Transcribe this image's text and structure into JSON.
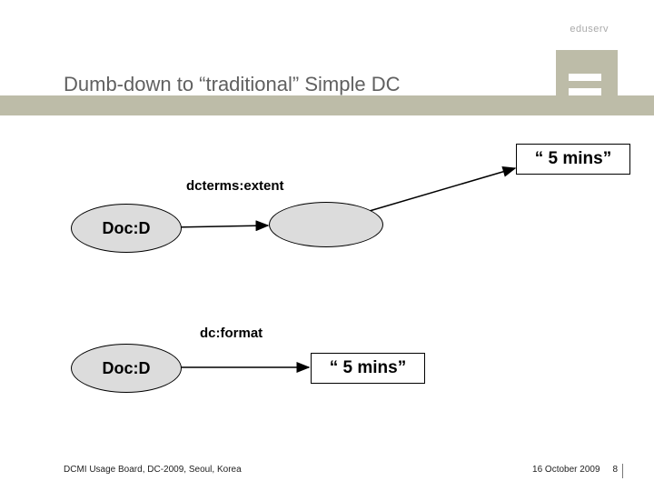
{
  "brand": {
    "name": "eduserv"
  },
  "slide": {
    "title": "Dumb-down to “traditional” Simple DC"
  },
  "diagram": {
    "nodes": {
      "doc_d_top": "Doc:D",
      "doc_d_bottom": "Doc:D",
      "value_top": "“ 5 mins”",
      "value_bottom": "“ 5 mins”",
      "blank_node": ""
    },
    "edges": {
      "dcterms_extent": "dcterms:extent",
      "dc_format": "dc:format"
    }
  },
  "footer": {
    "left": "DCMI Usage Board, DC-2009, Seoul, Korea",
    "date": "16 October 2009",
    "page": "8"
  }
}
